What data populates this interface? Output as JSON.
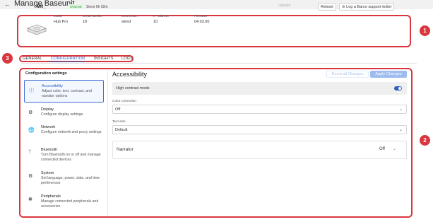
{
  "header": {
    "back_icon": "arrow-left-icon",
    "title": "Manage Baseunit"
  },
  "device": {
    "name": "MR_",
    "status": "ONLINE",
    "since": "Since 6h 02m",
    "fields": [
      {
        "label": "Model",
        "value": "Hub Pro"
      },
      {
        "label": "Serial Number",
        "value": "18"
      },
      {
        "label": "Connection",
        "value": "wired"
      },
      {
        "label": "IP Address",
        "value": "10"
      },
      {
        "label": "Firmware",
        "value": "04.03.00"
      }
    ],
    "actions": {
      "update": "Update",
      "reboot": "Reboot",
      "support": "Log a Barco support ticket"
    }
  },
  "tabs": [
    {
      "label": "GENERAL",
      "active": false
    },
    {
      "label": "CONFIGURATION",
      "active": true
    },
    {
      "label": "INSIGHTS",
      "active": false
    },
    {
      "label": "LOGS",
      "active": false
    }
  ],
  "sidebar": {
    "title": "Configuration settings",
    "items": [
      {
        "icon": "accessibility-icon",
        "title": "Accessibility",
        "desc": "Adjust color, text, contrast, and narrator options",
        "active": true
      },
      {
        "icon": "display-settings-icon",
        "title": "Display",
        "desc": "Configure display settings",
        "active": false
      },
      {
        "icon": "globe-icon",
        "title": "Network",
        "desc": "Configure network and proxy settings",
        "active": false
      },
      {
        "icon": "bluetooth-icon",
        "title": "Bluetooth",
        "desc": "Turn Bluetooth on or off and manage connected devices",
        "active": false
      },
      {
        "icon": "system-settings-icon",
        "title": "System",
        "desc": "Set language, power, date, and time preferences",
        "active": false
      },
      {
        "icon": "peripherals-icon",
        "title": "Peripherals",
        "desc": "Manage connected peripherals and accessories",
        "active": false
      }
    ]
  },
  "main": {
    "title": "Accessibility",
    "reset_label": "Reset all Changes",
    "apply_label": "Apply Changes",
    "high_contrast": {
      "label": "High contrast mode",
      "enabled": true
    },
    "color_correction": {
      "label": "Color correction",
      "value": "Off"
    },
    "text_size": {
      "label": "Text size",
      "value": "Default"
    },
    "narrator": {
      "label": "Narrator",
      "value": "Off"
    }
  },
  "annotations": [
    "1",
    "2",
    "3"
  ],
  "colors": {
    "accent": "#2c5fc2",
    "highlight": "#d9363e",
    "online": "#2f9a3c"
  }
}
